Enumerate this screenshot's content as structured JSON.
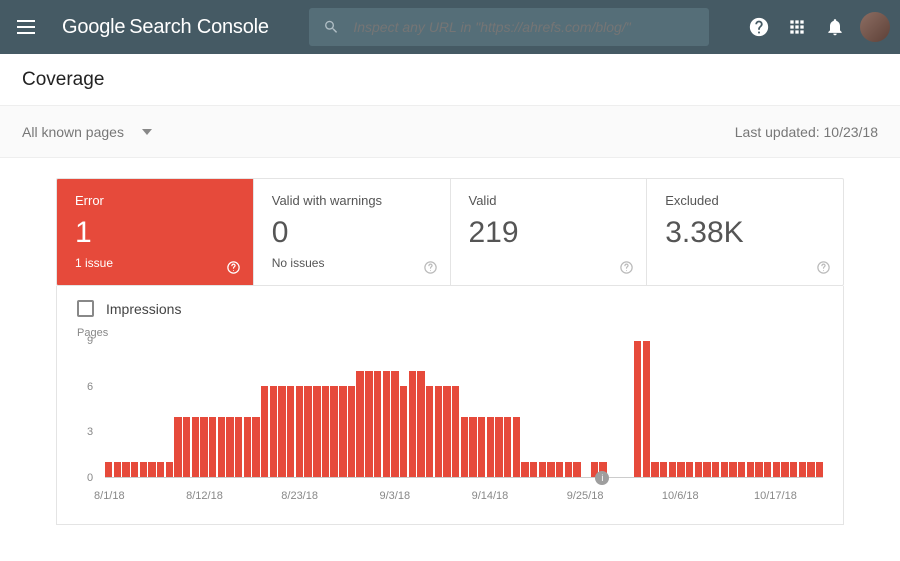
{
  "header": {
    "logo_bold": "Google",
    "logo_thin": "Search Console",
    "search_placeholder": "Inspect any URL in \"https://ahrefs.com/blog/\""
  },
  "subheader": {
    "title": "Coverage"
  },
  "filterbar": {
    "dropdown_label": "All known pages",
    "last_updated": "Last updated: 10/23/18"
  },
  "cards": {
    "error": {
      "title": "Error",
      "value": "1",
      "sub": "1 issue"
    },
    "warnings": {
      "title": "Valid with warnings",
      "value": "0",
      "sub": "No issues"
    },
    "valid": {
      "title": "Valid",
      "value": "219",
      "sub": ""
    },
    "excluded": {
      "title": "Excluded",
      "value": "3.38K",
      "sub": ""
    }
  },
  "chart": {
    "checkbox_label": "Impressions",
    "ylabel": "Pages"
  },
  "chart_data": {
    "type": "bar",
    "ylabel": "Pages",
    "ylim": [
      0,
      9
    ],
    "yticks": [
      0,
      3,
      6,
      9
    ],
    "x_tick_labels": [
      "8/1/18",
      "8/12/18",
      "8/23/18",
      "9/3/18",
      "9/14/18",
      "9/25/18",
      "10/6/18",
      "10/17/18"
    ],
    "x_tick_positions": [
      0,
      11,
      22,
      33,
      44,
      55,
      66,
      77
    ],
    "marker_position": 57,
    "values": [
      1,
      1,
      1,
      1,
      1,
      1,
      1,
      1,
      4,
      4,
      4,
      4,
      4,
      4,
      4,
      4,
      4,
      4,
      6,
      6,
      6,
      6,
      6,
      6,
      6,
      6,
      6,
      6,
      6,
      7,
      7,
      7,
      7,
      7,
      6,
      7,
      7,
      6,
      6,
      6,
      6,
      4,
      4,
      4,
      4,
      4,
      4,
      4,
      1,
      1,
      1,
      1,
      1,
      1,
      1,
      0,
      1,
      1,
      0,
      0,
      0,
      9,
      9,
      1,
      1,
      1,
      1,
      1,
      1,
      1,
      1,
      1,
      1,
      1,
      1,
      1,
      1,
      1,
      1,
      1,
      1,
      1,
      1
    ]
  }
}
